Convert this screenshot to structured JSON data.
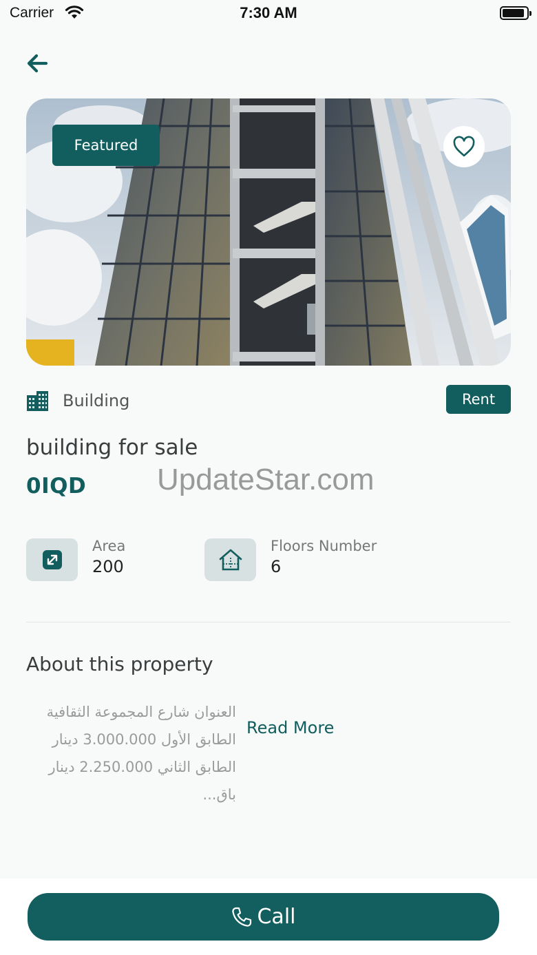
{
  "status_bar": {
    "carrier": "Carrier",
    "time": "7:30 AM",
    "battery_level": 0.9
  },
  "hero": {
    "badge": "Featured"
  },
  "property": {
    "type": "Building",
    "listing_type": "Rent",
    "title": "building for sale",
    "price": "0IQD"
  },
  "watermark": "UpdateStar.com",
  "stats": [
    {
      "label": "Area",
      "value": "200",
      "icon": "resize-arrows-icon"
    },
    {
      "label": "Floors Number",
      "value": "6",
      "icon": "house-floors-icon"
    }
  ],
  "about": {
    "heading": "About this property",
    "lines": [
      "العنوان شارع المجموعة الثقافية",
      "الطابق الأول 3.000.000 دينار",
      "الطابق الثاني 2.250.000 دينار",
      "باق..."
    ],
    "read_more": "Read More"
  },
  "call_label": "Call",
  "colors": {
    "primary": "#125e5e",
    "icon_bg": "#d7e1e1",
    "background": "#f8f9f9"
  }
}
